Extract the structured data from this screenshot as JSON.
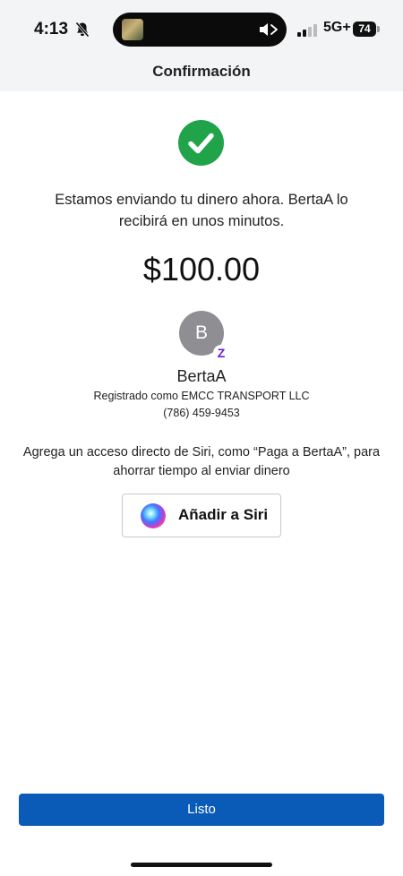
{
  "status_bar": {
    "time": "4:13",
    "network": "5G+",
    "battery": "74"
  },
  "header": {
    "title": "Confirmación"
  },
  "confirmation": {
    "message": "Estamos enviando tu dinero ahora. BertaA lo recibirá en unos minutos.",
    "amount": "$100.00"
  },
  "recipient": {
    "initial": "B",
    "badge": "Z",
    "name": "BertaA",
    "registered_as": "Registrado como EMCC TRANSPORT LLC",
    "phone": "(786) 459-9453"
  },
  "siri": {
    "description": "Agrega un acceso directo de Siri, como “Paga a BertaA”, para ahorrar tiempo al enviar dinero",
    "button_label": "Añadir a Siri"
  },
  "footer": {
    "done_label": "Listo"
  },
  "colors": {
    "success": "#21a34a",
    "primary_button": "#0a5bb8",
    "zelle_badge": "#6d1ed4",
    "avatar": "#8e8e93"
  },
  "icons": [
    "bell-slash-icon",
    "mute-icon",
    "signal-icon",
    "battery-icon",
    "checkmark-icon",
    "siri-icon"
  ]
}
